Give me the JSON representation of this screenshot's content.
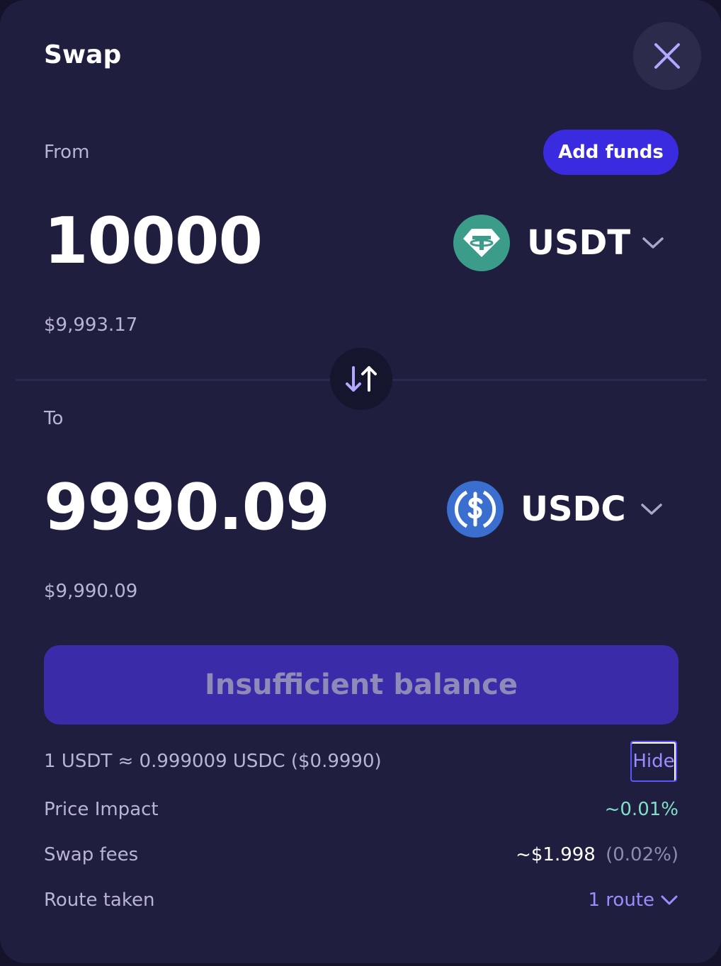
{
  "header": {
    "title": "Swap",
    "close_icon": "close-icon"
  },
  "from": {
    "label": "From",
    "add_funds_label": "Add funds",
    "amount": "10000",
    "usd_value": "$9,993.17",
    "token": {
      "symbol": "USDT",
      "icon": "tether-icon",
      "color": "#3b9c8a"
    }
  },
  "swap_direction_icon": "swap-arrows-icon",
  "to": {
    "label": "To",
    "amount": "9990.09",
    "usd_value": "$9,990.09",
    "token": {
      "symbol": "USDC",
      "icon": "usd-coin-icon",
      "color": "#3a6fd0"
    }
  },
  "action_button": {
    "label": "Insufficient balance",
    "enabled": false
  },
  "details": {
    "rate": "1 USDT ≈ 0.999009 USDC ($0.9990)",
    "hide_label": "Hide",
    "price_impact": {
      "label": "Price Impact",
      "value": "~0.01%",
      "color": "#7fe0c8"
    },
    "swap_fees": {
      "label": "Swap fees",
      "value": "~$1.998",
      "percent": "(0.02%)"
    },
    "route": {
      "label": "Route taken",
      "value": "1 route"
    }
  },
  "colors": {
    "background": "#201e3f",
    "accent": "#3a2be0",
    "link": "#9c8cff"
  }
}
